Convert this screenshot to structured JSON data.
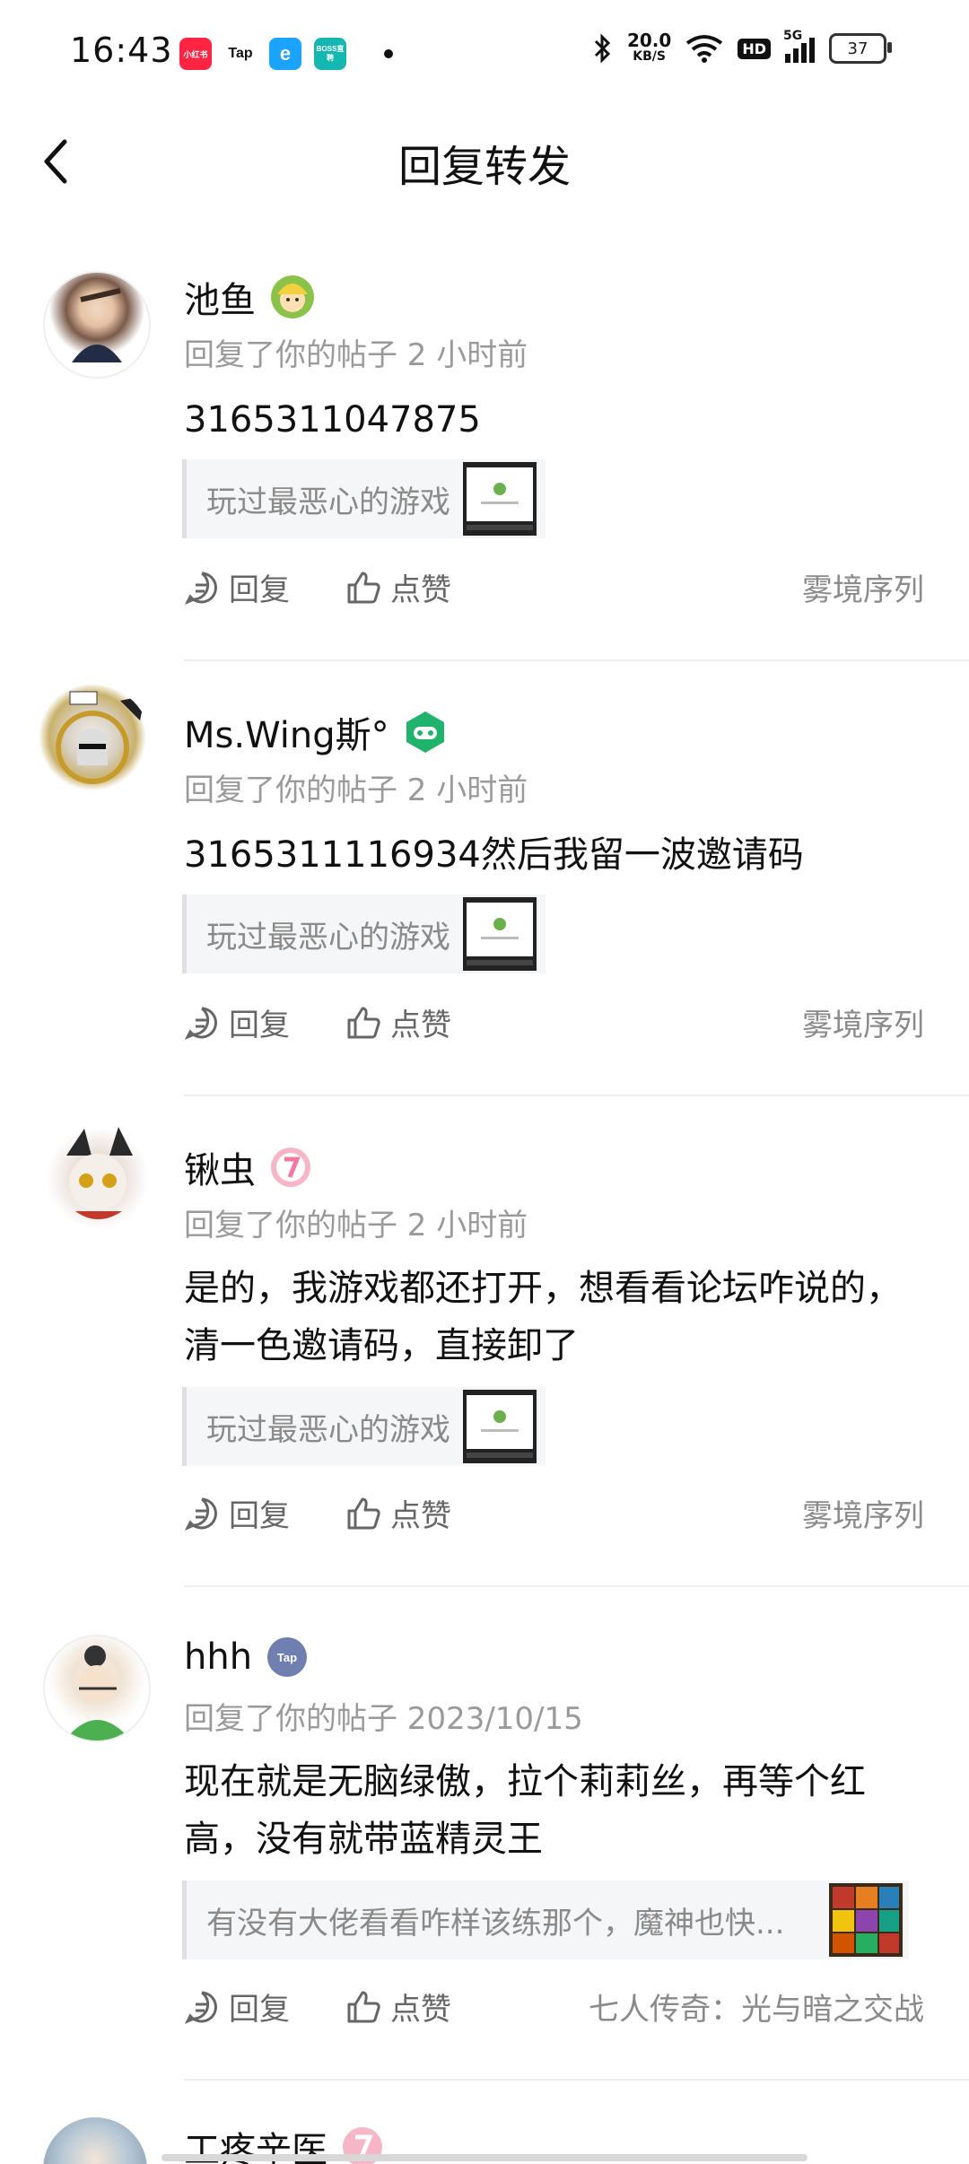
{
  "status_bar": {
    "time": "16:43",
    "apps": [
      {
        "label": "小红书",
        "color": "#ff2442"
      },
      {
        "label": "Tap",
        "color": "#ffffff"
      },
      {
        "label": "e",
        "color": "#1aa3ff"
      },
      {
        "label": "BOSS直聘",
        "color": "#14b8b0"
      }
    ],
    "net_speed": "20.0",
    "net_unit": "KB/S",
    "hd": "HD",
    "signal": "5G",
    "battery": "37"
  },
  "header": {
    "title": "回复转发"
  },
  "actions": {
    "reply": "回复",
    "like": "点赞"
  },
  "feed": [
    {
      "name": "池鱼",
      "meta": "回复了你的帖子 2 小时前",
      "content": "3165311047875",
      "ref": "玩过最恶心的游戏",
      "game": "雾境序列"
    },
    {
      "name": "Ms.Wing斯°",
      "meta": "回复了你的帖子 2 小时前",
      "content": "3165311116934然后我留一波邀请码",
      "ref": "玩过最恶心的游戏",
      "game": "雾境序列"
    },
    {
      "name": "锹虫",
      "meta": "回复了你的帖子 2 小时前",
      "content": "是的，我游戏都还打开，想看看论坛咋说的，清一色邀请码，直接卸了",
      "ref": "玩过最恶心的游戏",
      "game": "雾境序列"
    },
    {
      "name": "hhh",
      "meta": "回复了你的帖子 2023/10/15",
      "content": "现在就是无脑绿傲，拉个莉莉丝，再等个红高，没有就带蓝精灵王",
      "ref": "有没有大佬看看咋样该练那个，魔神也快...",
      "game": "七人传奇：光与暗之交战"
    },
    {
      "name": "工疼辛医",
      "meta": "",
      "content": "",
      "ref": "",
      "game": ""
    }
  ]
}
